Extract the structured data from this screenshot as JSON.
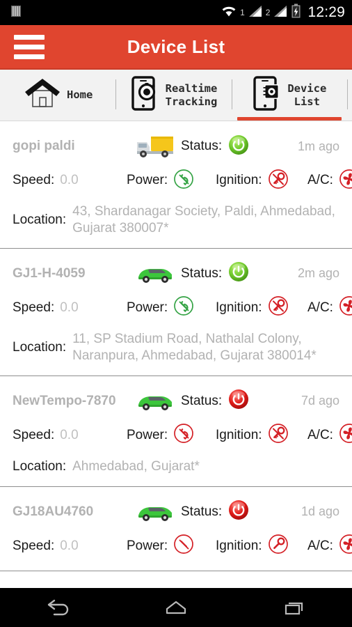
{
  "status_bar": {
    "notification_icon": "barcode-notification-icon",
    "wifi_icon": "wifi-icon",
    "sim1_label": "1",
    "sim1_icon": "signal-bars-icon",
    "sim2_label": "2",
    "sim2_icon": "signal-bars-icon",
    "battery_icon": "battery-charging-icon",
    "clock": "12:29"
  },
  "app_bar": {
    "menu_icon": "hamburger-menu-icon",
    "title": "Device List",
    "background_color": "#e0452f"
  },
  "tabs": [
    {
      "label": "Home",
      "icon": "home-icon",
      "active": false
    },
    {
      "label": "Realtime\nTracking",
      "icon": "realtime-tracking-icon",
      "active": false
    },
    {
      "label": "Device\nList",
      "icon": "device-list-icon",
      "active": true
    }
  ],
  "labels": {
    "status": "Status:",
    "speed": "Speed:",
    "power": "Power:",
    "ignition": "Ignition:",
    "ac": "A/C:",
    "location": "Location:"
  },
  "colors": {
    "accent_red": "#e0452f",
    "status_on_green": "#6fc82b",
    "status_off_red": "#e01b18",
    "power_on_green": "#35a345",
    "inactive_red": "#d42026",
    "muted_text": "#b2b2b2"
  },
  "devices": [
    {
      "name": "gopi paldi",
      "vehicle_icon": "yellow-truck-icon",
      "status": "on",
      "last_update": "1m ago",
      "speed": "0.0",
      "power": "on",
      "ignition": "off",
      "ac": "off",
      "location": "43, Shardanagar Society, Paldi, Ahmedabad, Gujarat 380007*"
    },
    {
      "name": "GJ1-H-4059",
      "vehicle_icon": "green-car-icon",
      "status": "on",
      "last_update": "2m ago",
      "speed": "0.0",
      "power": "on",
      "ignition": "off",
      "ac": "off",
      "location": "11, SP Stadium Road, Nathalal Colony, Naranpura, Ahmedabad, Gujarat 380014*"
    },
    {
      "name": "NewTempo-7870",
      "vehicle_icon": "green-car-icon",
      "status": "off",
      "last_update": "7d ago",
      "speed": "0.0",
      "power": "off",
      "ignition": "off",
      "ac": "off",
      "location": "Ahmedabad, Gujarat*"
    },
    {
      "name": "GJ18AU4760",
      "vehicle_icon": "green-car-icon",
      "status": "off",
      "last_update": "1d ago",
      "speed": "0.0",
      "power": "off",
      "ignition": "off",
      "ac": "off",
      "location": ""
    }
  ],
  "nav_bar": {
    "back_icon": "back-arrow-icon",
    "home_icon": "home-nav-icon",
    "recents_icon": "recent-apps-icon"
  }
}
